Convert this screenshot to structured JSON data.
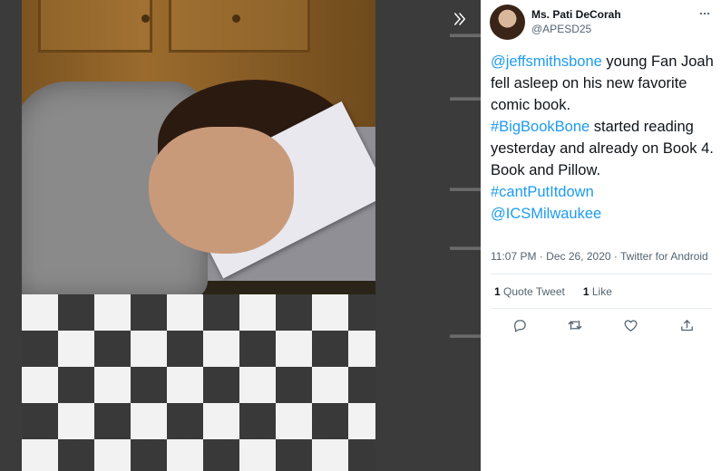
{
  "tweet": {
    "author_name": "Ms. Pati DeCorah",
    "author_handle": "@APESD25",
    "mention_1": "@jeffsmithsbone",
    "text_1": " young Fan Joah fell asleep on his new favorite comic book.",
    "hashtag_1": "#BigBookBone",
    "text_2": " started reading yesterday and already on Book 4.",
    "text_3": "Book and Pillow.",
    "hashtag_2": "#cantPutItdown",
    "mention_2": "@ICSMilwaukee",
    "time": "11:07 PM",
    "separator": " · ",
    "date": "Dec 26, 2020",
    "source": "Twitter for Android"
  },
  "stats": {
    "quote_count": "1",
    "quote_label": " Quote Tweet",
    "like_count": "1",
    "like_label": " Like"
  },
  "icons": {
    "expand": "double-chevron-right-icon",
    "more": "more-horizontal-icon",
    "reply": "reply-icon",
    "retweet": "retweet-icon",
    "like": "heart-icon",
    "share": "share-icon"
  },
  "colors": {
    "accent": "#1d9bf0",
    "text": "#0f1419",
    "muted": "#536471"
  }
}
